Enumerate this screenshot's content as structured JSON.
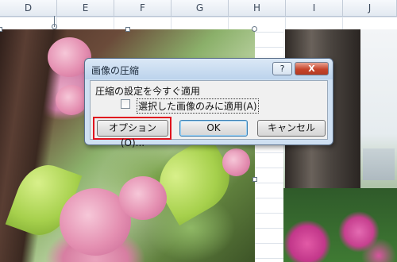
{
  "spreadsheet": {
    "columns": [
      "D",
      "E",
      "F",
      "G",
      "H",
      "I",
      "J"
    ]
  },
  "dialog": {
    "title": "画像の圧縮",
    "help_label": "?",
    "close_label": "X",
    "section_label": "圧縮の設定を今すぐ適用",
    "checkbox_label": "選択した画像のみに適用(A)",
    "checkbox_checked": false,
    "buttons": {
      "options": "オプション(O)...",
      "ok": "OK",
      "cancel": "キャンセル"
    }
  },
  "colors": {
    "highlight": "#e0141e",
    "dialog_frame": "#cfe0f2",
    "close_button": "#c6452c"
  }
}
